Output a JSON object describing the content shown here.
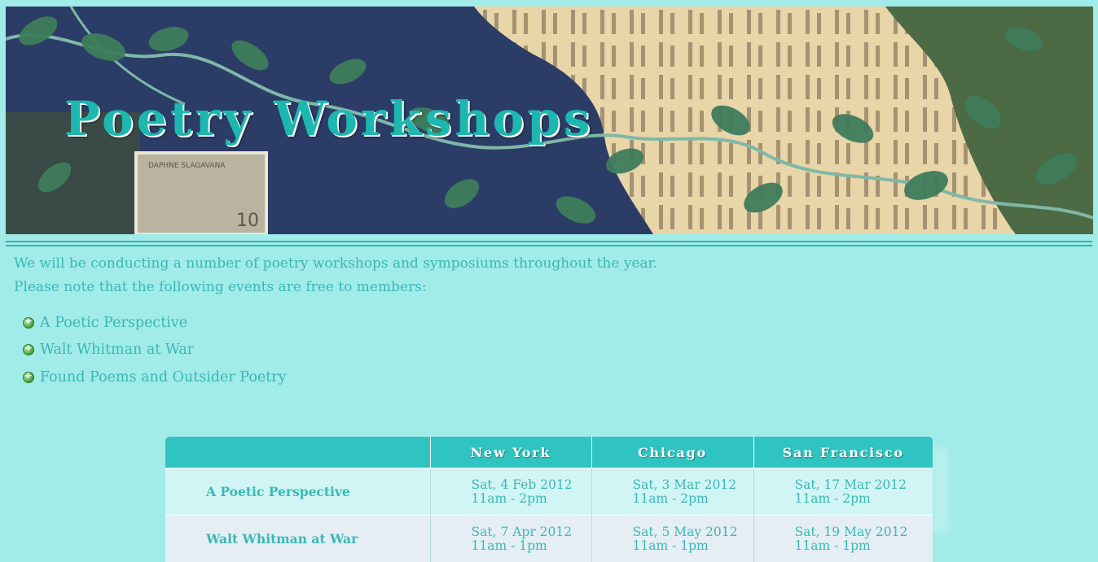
{
  "banner": {
    "title": "Poetry Workshops",
    "stamp_text": "DAPHNE SLAGAVANA",
    "stamp_value": "10"
  },
  "intro": {
    "line1": "We will be conducting a number of poetry workshops and symposiums throughout the year.",
    "line2": "Please note that the following events are free to members:"
  },
  "events": [
    "A Poetic Perspective",
    "Walt Whitman at War",
    "Found Poems and Outsider Poetry"
  ],
  "schedule": {
    "headers": [
      "",
      "New York",
      "Chicago",
      "San Francisco"
    ],
    "rows": [
      {
        "event": "A Poetic Perspective",
        "new_york": {
          "date": "Sat, 4 Feb 2012",
          "time": "11am - 2pm"
        },
        "chicago": {
          "date": "Sat, 3 Mar 2012",
          "time": "11am - 2pm"
        },
        "san_francisco": {
          "date": "Sat, 17 Mar 2012",
          "time": "11am - 2pm"
        }
      },
      {
        "event": "Walt Whitman at War",
        "new_york": {
          "date": "Sat, 7 Apr 2012",
          "time": "11am - 1pm"
        },
        "chicago": {
          "date": "Sat, 5 May 2012",
          "time": "11am - 1pm"
        },
        "san_francisco": {
          "date": "Sat, 19 May 2012",
          "time": "11am - 1pm"
        }
      }
    ]
  },
  "colors": {
    "background": "#a1ebe9",
    "text": "#3ab8b4",
    "header": "#2fc4c2",
    "row_a": "#d1f5f5",
    "row_b": "#e4eef4"
  }
}
